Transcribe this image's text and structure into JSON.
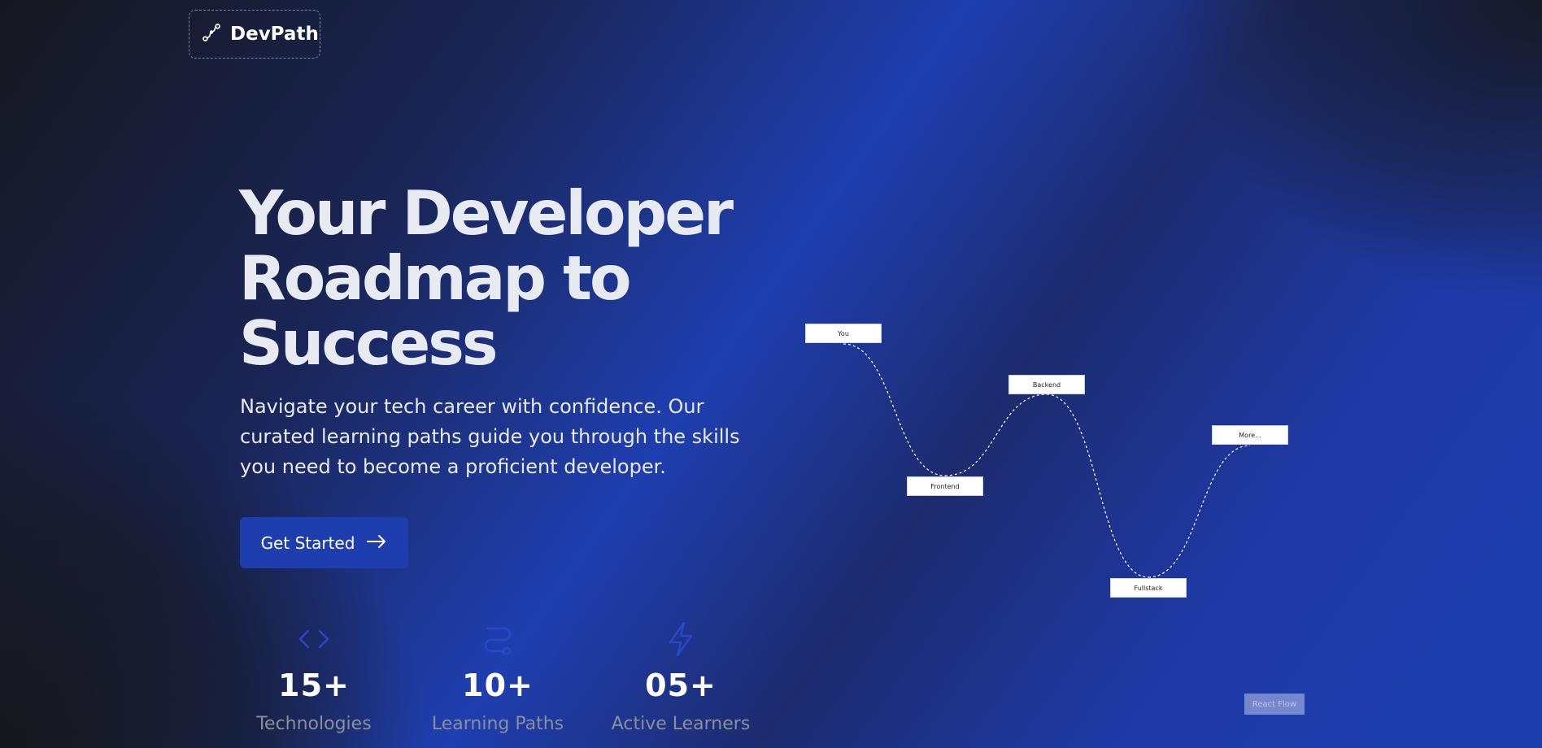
{
  "brand": {
    "name": "DevPath",
    "icon": "route-icon"
  },
  "hero": {
    "title": "Your Developer Roadmap to Success",
    "subtitle": "Navigate your tech career with confidence. Our curated learning paths guide you through the skills you need to become a proficient developer.",
    "cta_label": "Get Started",
    "cta_icon": "arrow-right-icon"
  },
  "stats": [
    {
      "icon": "code-icon",
      "value": "15+",
      "label": "Technologies"
    },
    {
      "icon": "route-icon",
      "value": "10+",
      "label": "Learning Paths"
    },
    {
      "icon": "zap-icon",
      "value": "05+",
      "label": "Active Learners"
    }
  ],
  "roadmap": {
    "nodes": [
      "You",
      "Frontend",
      "Backend",
      "More...",
      "Fullstack"
    ]
  },
  "attribution": {
    "label": "React Flow"
  },
  "colors": {
    "accent": "#1e3eb0",
    "icon": "#2b47c9",
    "background_dark": "#16171d"
  }
}
